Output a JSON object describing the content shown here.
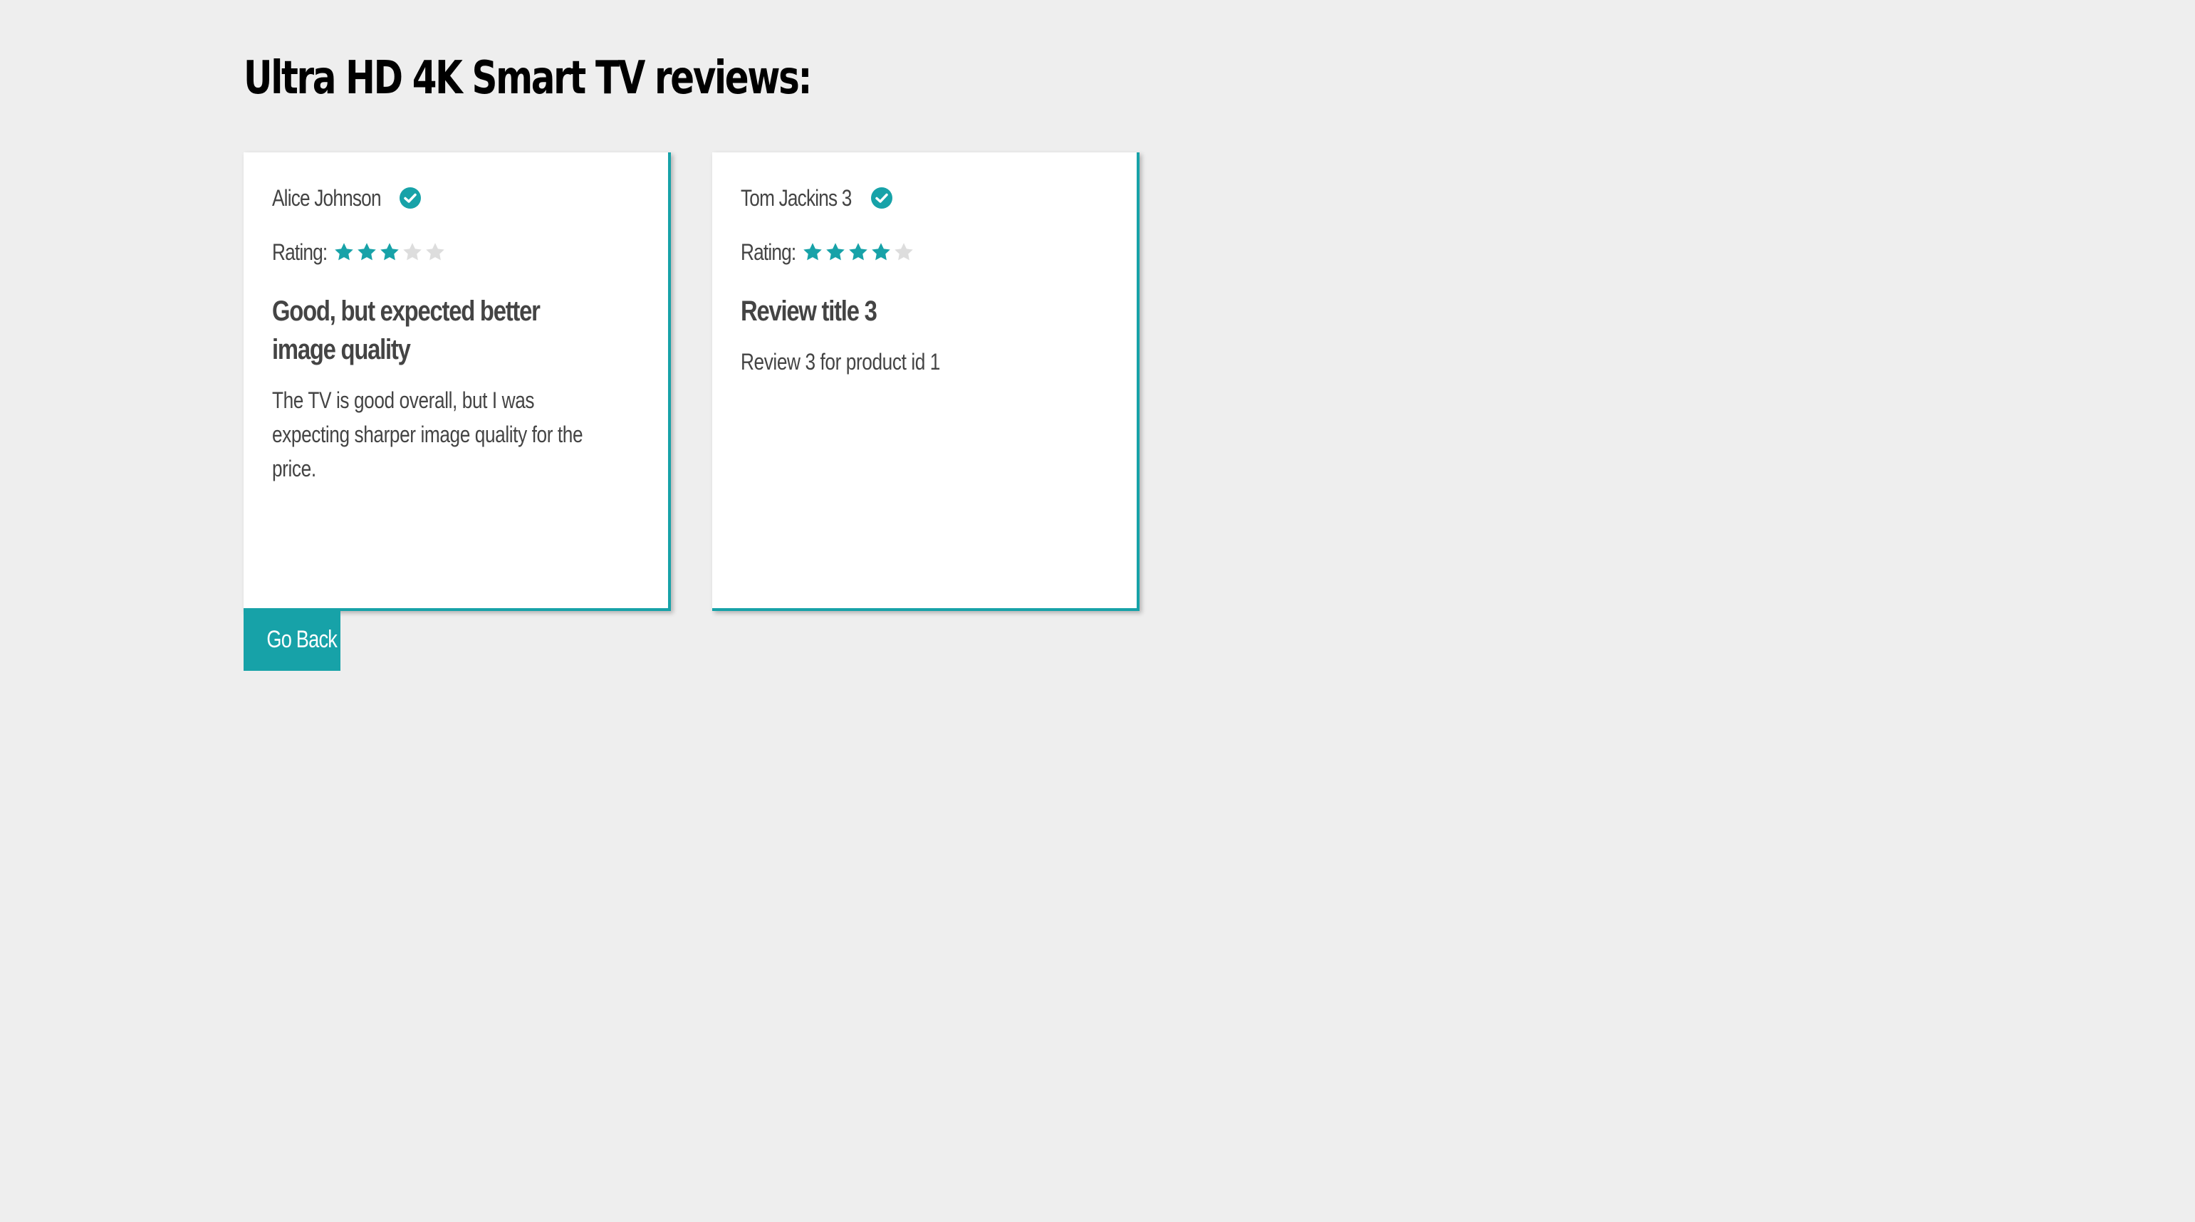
{
  "page": {
    "title": "Ultra HD 4K Smart TV reviews:"
  },
  "colors": {
    "accent": "#17a2a8",
    "star_filled": "#17a2a8",
    "star_empty": "#dddddd",
    "background": "#eeeeee"
  },
  "rating_label": "Rating:",
  "reviews": [
    {
      "author": "Alice Johnson",
      "verified_icon": "check-circle-icon",
      "rating": 3,
      "rating_max": 5,
      "title": "Good, but expected better image quality",
      "body": "The TV is good overall, but I was expecting sharper image quality for the price."
    },
    {
      "author": "Tom Jackins 3",
      "verified_icon": "check-circle-icon",
      "rating": 4,
      "rating_max": 5,
      "title": "Review title 3",
      "body": "Review 3 for product id 1"
    }
  ],
  "actions": {
    "go_back_label": "Go Back"
  }
}
